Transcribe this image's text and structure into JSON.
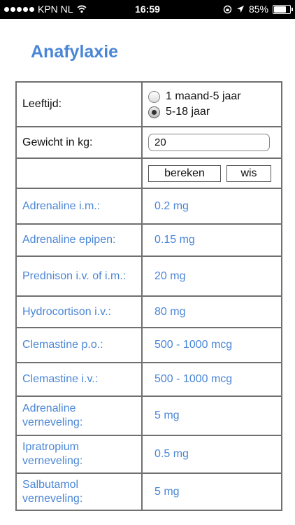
{
  "status_bar": {
    "carrier": "KPN NL",
    "time": "16:59",
    "battery": "85%",
    "battery_level": 0.85,
    "icons": [
      "signal-dots-icon",
      "wifi-icon",
      "orientation-lock-icon",
      "location-arrow-icon",
      "battery-icon"
    ]
  },
  "page": {
    "title": "Anafylaxie"
  },
  "form": {
    "age_label": "Leeftijd:",
    "age_options": [
      "1 maand-5 jaar",
      "5-18 jaar"
    ],
    "age_selected": "5-18 jaar",
    "weight_label": "Gewicht in kg:",
    "weight_value": "20",
    "calc_button": "bereken",
    "clear_button": "wis"
  },
  "results": [
    {
      "drug": "Adrenaline i.m.:",
      "dose": "0.2 mg"
    },
    {
      "drug": "Adrenaline epipen:",
      "dose": "0.15 mg"
    },
    {
      "drug": "Prednison i.v. of i.m.:",
      "dose": "20 mg"
    },
    {
      "drug": "Hydrocortison i.v.:",
      "dose": "80 mg"
    },
    {
      "drug": "Clemastine p.o.:",
      "dose": "500 - 1000 mcg"
    },
    {
      "drug": "Clemastine i.v.:",
      "dose": "500 - 1000 mcg"
    },
    {
      "drug": "Adrenaline verneveling:",
      "dose": "5 mg"
    },
    {
      "drug": "Ipratropium verneveling:",
      "dose": "0.5 mg"
    },
    {
      "drug": "Salbutamol verneveling:",
      "dose": "5 mg"
    }
  ],
  "colors": {
    "accent": "#4a86d6",
    "border": "#707070",
    "statusbar": "#000000"
  }
}
